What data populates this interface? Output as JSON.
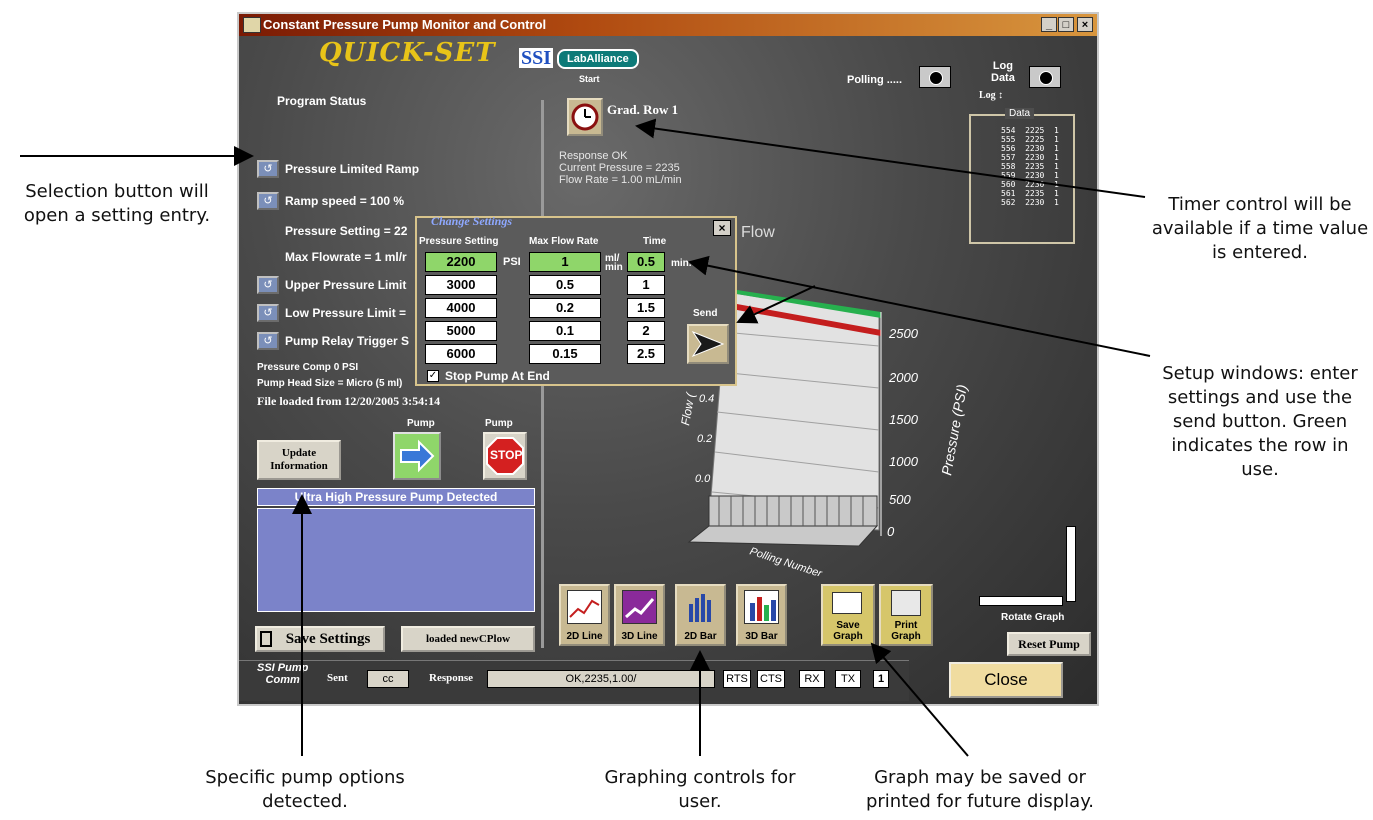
{
  "window": {
    "title": "Constant Pressure Pump Monitor and Control",
    "controls": [
      "_",
      "□",
      "×"
    ]
  },
  "brand": {
    "quickset": "QUICK-SET",
    "ssi": "SSI",
    "laballiance": "LabAlliance"
  },
  "header": {
    "polling_label": "Polling .....",
    "log_data_label_1": "Log",
    "log_data_label_2": "Data",
    "log_label": "Log ↕"
  },
  "program": {
    "status_label": "Program Status",
    "items": [
      "Pressure Limited Ramp",
      "Ramp speed = 100 %",
      "Upper Pressure Limit",
      "Low Pressure Limit =",
      "Pump Relay Trigger S"
    ],
    "pressure_setting": "Pressure Setting = 22",
    "max_flowrate": "Max Flowrate = 1 ml/r",
    "pressure_comp": "Pressure Comp 0 PSI",
    "pump_head": "Pump Head Size = Micro (5 ml)",
    "file_loaded": "File loaded from 12/20/2005 3:54:14"
  },
  "start": {
    "label": "Start",
    "row": "Grad. Row 1"
  },
  "response": {
    "line1": "Response  OK",
    "line2": "Current Pressure = 2235",
    "line3": "Flow Rate = 1.00 mL/min"
  },
  "data_panel": {
    "title": "Data",
    "rows": [
      "554  2225  1",
      "555  2225  1",
      "556  2230  1",
      "557  2230  1",
      "558  2235  1",
      "559  2230  1",
      "560  2230  1",
      "561  2235  1",
      "562  2230  1"
    ]
  },
  "dialog": {
    "title": "Change Settings",
    "col_pressure": "Pressure Setting",
    "col_flow": "Max Flow Rate",
    "col_time": "Time",
    "unit_psi": "PSI",
    "unit_flow": "ml/ min",
    "unit_time": "min.",
    "send_label": "Send",
    "stop_label": "Stop Pump At End",
    "rows": [
      {
        "pressure": "2200",
        "flow": "1",
        "time": "0.5"
      },
      {
        "pressure": "3000",
        "flow": "0.5",
        "time": "1"
      },
      {
        "pressure": "4000",
        "flow": "0.2",
        "time": "1.5"
      },
      {
        "pressure": "5000",
        "flow": "0.1",
        "time": "2"
      },
      {
        "pressure": "6000",
        "flow": "0.15",
        "time": "2.5"
      }
    ]
  },
  "pump": {
    "update_label": "Update Information",
    "pump_label": "Pump",
    "stop_label": "STOP",
    "detected": "Ultra High Pressure Pump Detected"
  },
  "buttons": {
    "save_settings": "Save Settings",
    "loaded": "loaded newCPlow",
    "rotate": "Rotate Graph",
    "reset_pump": "Reset Pump",
    "close": "Close"
  },
  "graph_buttons": [
    "2D Line",
    "3D Line",
    "2D Bar",
    "3D Bar",
    "Save Graph",
    "Print Graph"
  ],
  "chart": {
    "title": "Flow",
    "ylabel_right": "Pressure (PSI)",
    "ylabel_left": "Flow (",
    "xlabel": "Polling Number",
    "pressure_ticks": [
      "2500",
      "2000",
      "1500",
      "1000",
      "500",
      "0"
    ],
    "flow_ticks": [
      "0.4",
      "0.2",
      "0.0"
    ]
  },
  "comm": {
    "label_1": "SSI Pump",
    "label_2": "Comm",
    "sent_label": "Sent",
    "sent_value": "cc",
    "response_label": "Response",
    "response_value": "OK,2235,1.00/",
    "rts": "RTS",
    "cts": "CTS",
    "rx": "RX",
    "tx": "TX",
    "count": "1"
  },
  "callouts": {
    "selection": "Selection button will open a setting entry.",
    "timer": "Timer control will be available if a time value is entered.",
    "setup": "Setup windows: enter settings and use the send button. Green indicates the row in use.",
    "pump_options": "Specific pump options detected.",
    "graphing": "Graphing controls for user.",
    "graph_save": "Graph may be saved or printed for future display."
  },
  "colors": {
    "title_gradient": "#7a1a04",
    "green_row": "#8fd66a",
    "detected_bar": "#7b83c9",
    "close_btn": "#f0dca0"
  }
}
